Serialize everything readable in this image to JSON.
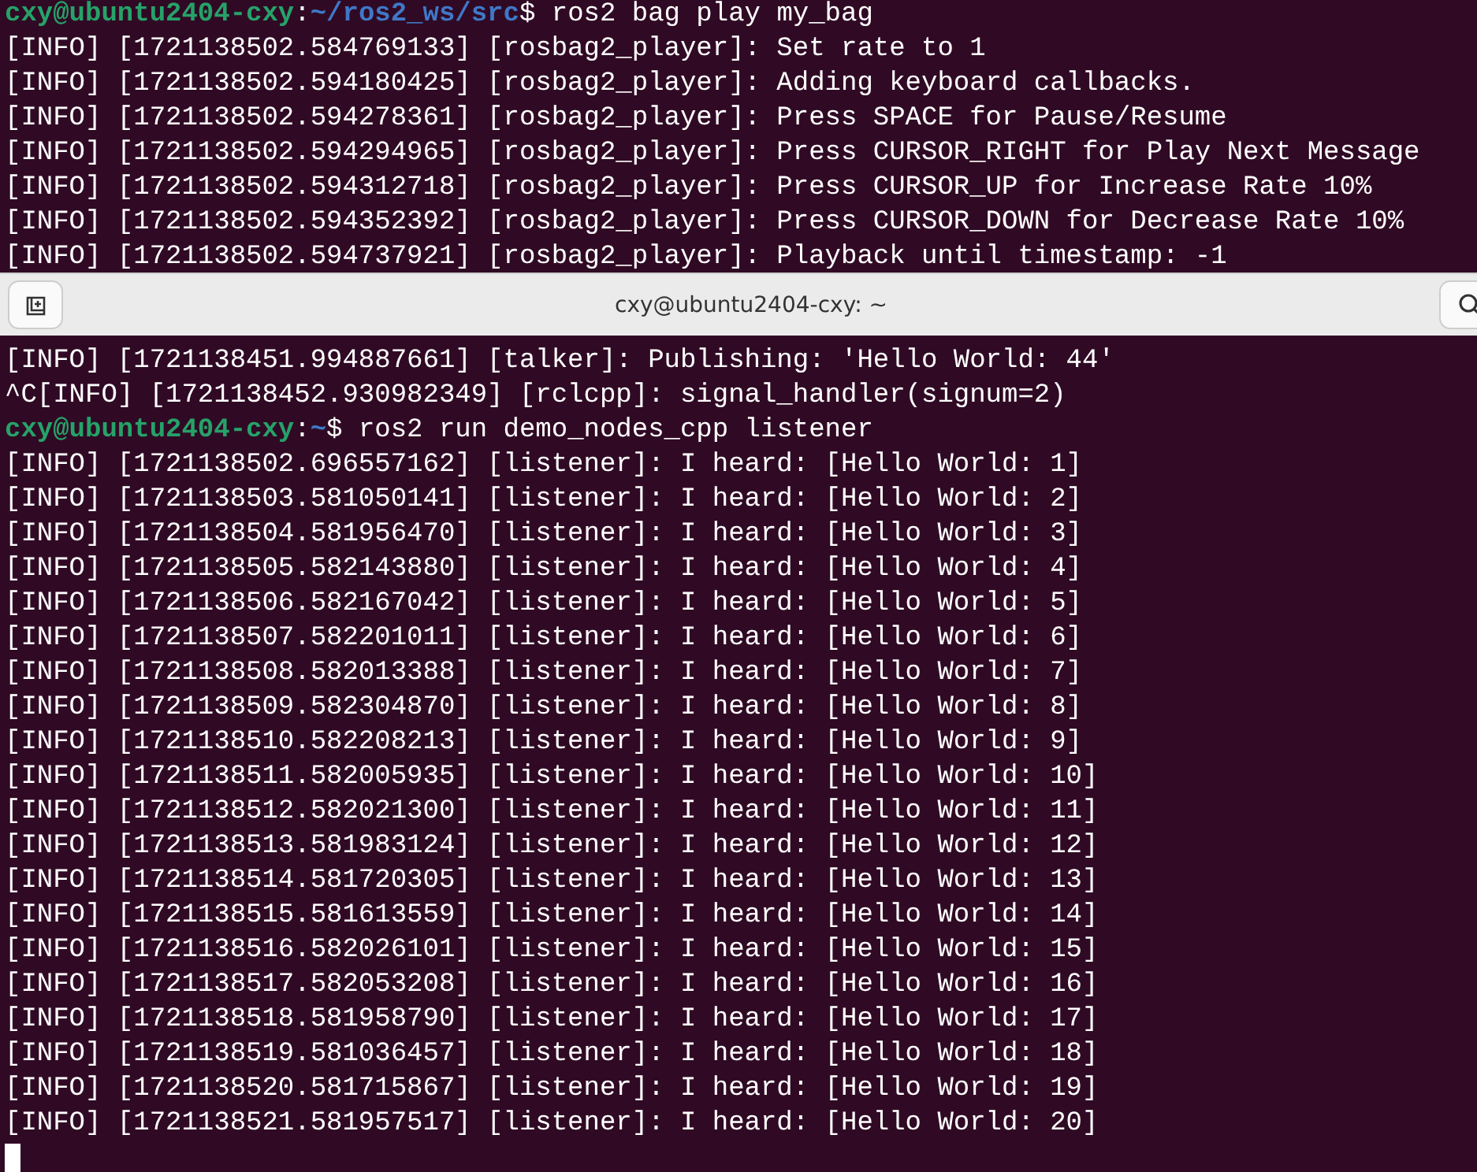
{
  "back_terminal": {
    "lines": [
      {
        "kind": "prompt",
        "user_host": "cxy@ubuntu2404-cxy",
        "separator": ":",
        "path": "~/ros2_ws/src",
        "command": "$ ros2 bag play my_bag"
      },
      {
        "kind": "output",
        "text": "[INFO] [1721138502.584769133] [rosbag2_player]: Set rate to 1"
      },
      {
        "kind": "output",
        "text": "[INFO] [1721138502.594180425] [rosbag2_player]: Adding keyboard callbacks."
      },
      {
        "kind": "output",
        "text": "[INFO] [1721138502.594278361] [rosbag2_player]: Press SPACE for Pause/Resume"
      },
      {
        "kind": "output",
        "text": "[INFO] [1721138502.594294965] [rosbag2_player]: Press CURSOR_RIGHT for Play Next Message"
      },
      {
        "kind": "output",
        "text": "[INFO] [1721138502.594312718] [rosbag2_player]: Press CURSOR_UP for Increase Rate 10%"
      },
      {
        "kind": "output",
        "text": "[INFO] [1721138502.594352392] [rosbag2_player]: Press CURSOR_DOWN for Decrease Rate 10%"
      },
      {
        "kind": "output",
        "text": "[INFO] [1721138502.594737921] [rosbag2_player]: Playback until timestamp: -1"
      }
    ]
  },
  "front_terminal": {
    "title": "cxy@ubuntu2404-cxy: ~",
    "cursor_visible": true,
    "lines": [
      {
        "kind": "output",
        "text": "[INFO] [1721138451.994887661] [talker]: Publishing: 'Hello World: 44'"
      },
      {
        "kind": "output",
        "text": "^C[INFO] [1721138452.930982349] [rclcpp]: signal_handler(signum=2)"
      },
      {
        "kind": "prompt",
        "user_host": "cxy@ubuntu2404-cxy",
        "separator": ":",
        "path": "~",
        "command": "$ ros2 run demo_nodes_cpp listener"
      },
      {
        "kind": "output",
        "text": "[INFO] [1721138502.696557162] [listener]: I heard: [Hello World: 1]"
      },
      {
        "kind": "output",
        "text": "[INFO] [1721138503.581050141] [listener]: I heard: [Hello World: 2]"
      },
      {
        "kind": "output",
        "text": "[INFO] [1721138504.581956470] [listener]: I heard: [Hello World: 3]"
      },
      {
        "kind": "output",
        "text": "[INFO] [1721138505.582143880] [listener]: I heard: [Hello World: 4]"
      },
      {
        "kind": "output",
        "text": "[INFO] [1721138506.582167042] [listener]: I heard: [Hello World: 5]"
      },
      {
        "kind": "output",
        "text": "[INFO] [1721138507.582201011] [listener]: I heard: [Hello World: 6]"
      },
      {
        "kind": "output",
        "text": "[INFO] [1721138508.582013388] [listener]: I heard: [Hello World: 7]"
      },
      {
        "kind": "output",
        "text": "[INFO] [1721138509.582304870] [listener]: I heard: [Hello World: 8]"
      },
      {
        "kind": "output",
        "text": "[INFO] [1721138510.582208213] [listener]: I heard: [Hello World: 9]"
      },
      {
        "kind": "output",
        "text": "[INFO] [1721138511.582005935] [listener]: I heard: [Hello World: 10]"
      },
      {
        "kind": "output",
        "text": "[INFO] [1721138512.582021300] [listener]: I heard: [Hello World: 11]"
      },
      {
        "kind": "output",
        "text": "[INFO] [1721138513.581983124] [listener]: I heard: [Hello World: 12]"
      },
      {
        "kind": "output",
        "text": "[INFO] [1721138514.581720305] [listener]: I heard: [Hello World: 13]"
      },
      {
        "kind": "output",
        "text": "[INFO] [1721138515.581613559] [listener]: I heard: [Hello World: 14]"
      },
      {
        "kind": "output",
        "text": "[INFO] [1721138516.582026101] [listener]: I heard: [Hello World: 15]"
      },
      {
        "kind": "output",
        "text": "[INFO] [1721138517.582053208] [listener]: I heard: [Hello World: 16]"
      },
      {
        "kind": "output",
        "text": "[INFO] [1721138518.581958790] [listener]: I heard: [Hello World: 17]"
      },
      {
        "kind": "output",
        "text": "[INFO] [1721138519.581036457] [listener]: I heard: [Hello World: 18]"
      },
      {
        "kind": "output",
        "text": "[INFO] [1721138520.581715867] [listener]: I heard: [Hello World: 19]"
      },
      {
        "kind": "output",
        "text": "[INFO] [1721138521.581957517] [listener]: I heard: [Hello World: 20]"
      }
    ]
  }
}
